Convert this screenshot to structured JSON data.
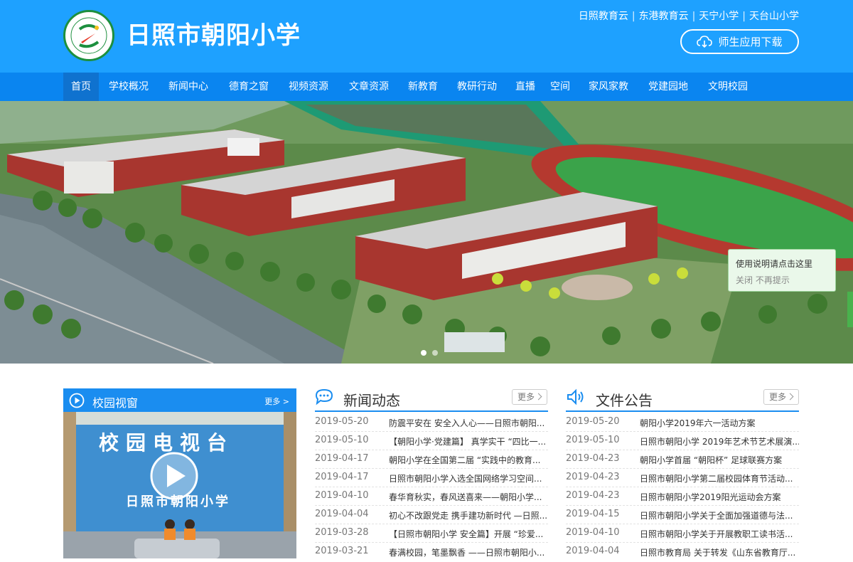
{
  "header": {
    "school_name": "日照市朝阳小学",
    "top_links": [
      "日照教育云",
      "东港教育云",
      "天宁小学",
      "天台山小学"
    ],
    "download_label": "师生应用下载"
  },
  "nav": {
    "items": [
      "首页",
      "学校概况",
      "新闻中心",
      "德育之窗",
      "视频资源",
      "文章资源",
      "新教育",
      "教研行动",
      "直播",
      "空间",
      "家风家教",
      "党建园地",
      "文明校园"
    ],
    "active_index": 0
  },
  "banner": {
    "slide_count": 2,
    "active_slide": 1,
    "tooltip": {
      "main": "使用说明请点击这里",
      "close": "关闭 不再提示"
    }
  },
  "campus_window": {
    "title": "校园视窗",
    "more": "更多 >",
    "video": {
      "sign_text": "校园电视台",
      "desk_text": "日照市朝阳小学"
    }
  },
  "news": {
    "title": "新闻动态",
    "more": "更多",
    "items": [
      {
        "date": "2019-05-20",
        "text": "防震平安在 安全入人心——日照市朝阳..."
      },
      {
        "date": "2019-05-10",
        "text": "【朝阳小学·党建篇】 真学实干 “四比一..."
      },
      {
        "date": "2019-04-17",
        "text": "朝阳小学在全国第二届 “实践中的教育..."
      },
      {
        "date": "2019-04-17",
        "text": "日照市朝阳小学入选全国网络学习空间..."
      },
      {
        "date": "2019-04-10",
        "text": "春华育秋实，春风送喜来——朝阳小学..."
      },
      {
        "date": "2019-04-04",
        "text": "初心不改跟党走 携手建功新时代 —日照..."
      },
      {
        "date": "2019-03-28",
        "text": "【日照市朝阳小学 安全篇】开展 “珍爱..."
      },
      {
        "date": "2019-03-21",
        "text": "春满校园，笔墨飘香 ——日照市朝阳小..."
      }
    ]
  },
  "notices": {
    "title": "文件公告",
    "more": "更多",
    "items": [
      {
        "date": "2019-05-20",
        "text": "朝阳小学2019年六一活动方案"
      },
      {
        "date": "2019-05-10",
        "text": "日照市朝阳小学 2019年艺术节艺术展演..."
      },
      {
        "date": "2019-04-23",
        "text": "朝阳小学首届 “朝阳杯” 足球联赛方案"
      },
      {
        "date": "2019-04-23",
        "text": "日照市朝阳小学第二届校园体育节活动..."
      },
      {
        "date": "2019-04-23",
        "text": "日照市朝阳小学2019阳光运动会方案"
      },
      {
        "date": "2019-04-15",
        "text": "日照市朝阳小学关于全面加强道德与法..."
      },
      {
        "date": "2019-04-10",
        "text": "日照市朝阳小学关于开展教职工读书活..."
      },
      {
        "date": "2019-04-04",
        "text": "日照市教育局 关于转发《山东省教育厅..."
      }
    ]
  },
  "colors": {
    "header_bg": "#1ea1ff",
    "nav_bg": "#0a85f0",
    "accent": "#1a8df0"
  },
  "icons": [
    "school-logo-icon",
    "cloud-download-icon",
    "play-circle-icon",
    "chat-bubble-icon",
    "speaker-icon",
    "chevron-right-icon"
  ]
}
